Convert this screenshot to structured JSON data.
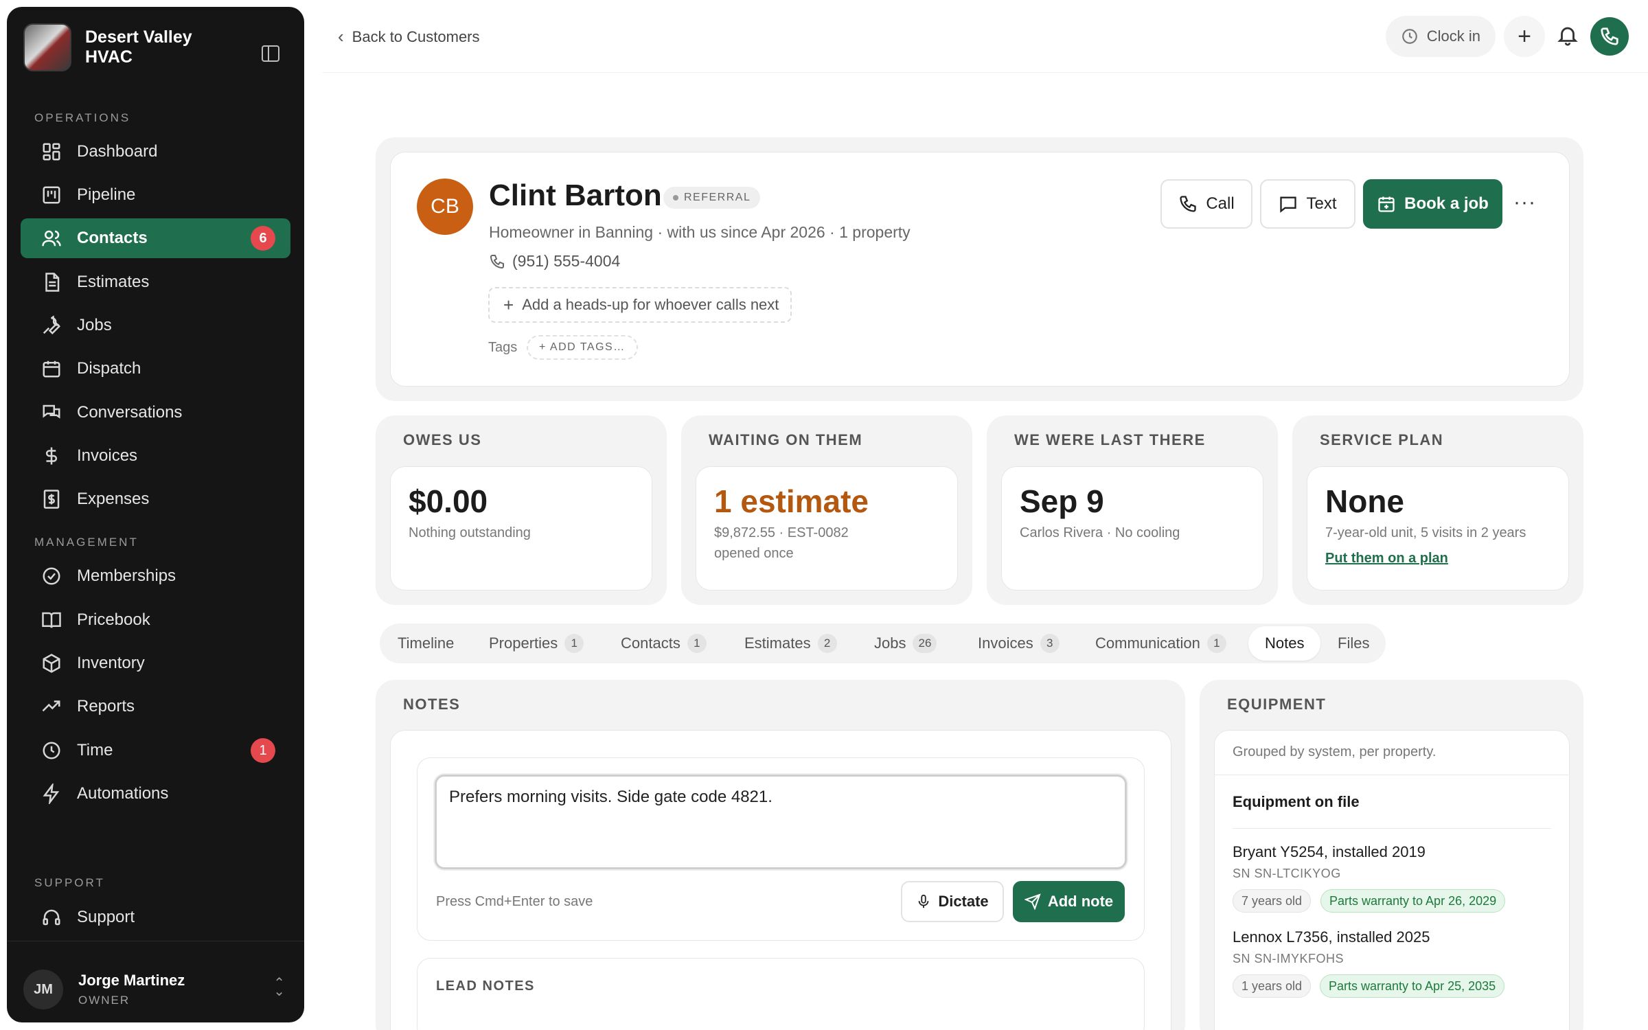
{
  "sidebar": {
    "brand_name": "Desert Valley HVAC",
    "sections": {
      "operations": "OPERATIONS",
      "management": "MANAGEMENT",
      "support": "SUPPORT"
    },
    "items": [
      {
        "label": "Dashboard",
        "icon": "dashboard-icon"
      },
      {
        "label": "Pipeline",
        "icon": "pipeline-icon"
      },
      {
        "label": "Contacts",
        "icon": "contacts-icon",
        "badge": "6",
        "active": true
      },
      {
        "label": "Estimates",
        "icon": "estimates-icon"
      },
      {
        "label": "Jobs",
        "icon": "wrench-icon"
      },
      {
        "label": "Dispatch",
        "icon": "calendar-icon"
      },
      {
        "label": "Conversations",
        "icon": "chat-icon"
      },
      {
        "label": "Invoices",
        "icon": "dollar-icon"
      },
      {
        "label": "Expenses",
        "icon": "receipt-icon"
      },
      {
        "label": "Memberships",
        "icon": "badge-check-icon"
      },
      {
        "label": "Pricebook",
        "icon": "book-icon"
      },
      {
        "label": "Inventory",
        "icon": "box-icon"
      },
      {
        "label": "Reports",
        "icon": "trend-icon"
      },
      {
        "label": "Time",
        "icon": "clock-icon",
        "badge": "1"
      },
      {
        "label": "Automations",
        "icon": "bolt-icon"
      },
      {
        "label": "Support",
        "icon": "headset-icon"
      }
    ],
    "user": {
      "initials": "JM",
      "name": "Jorge Martinez",
      "role": "OWNER"
    }
  },
  "topbar": {
    "back_label": "Back to Customers",
    "clock_label": "Clock in"
  },
  "customer": {
    "initials": "CB",
    "name": "Clint Barton",
    "tag": "REFERRAL",
    "subtitle": "Homeowner in Banning · with us since Apr 2026 · 1 property",
    "phone": "(951) 555-4004",
    "headsup_label": "Add a heads-up for whoever calls next",
    "tags_label": "Tags",
    "add_tags_label": "+ ADD TAGS…",
    "actions": {
      "call": "Call",
      "text": "Text",
      "book": "Book a job",
      "more": "···"
    }
  },
  "stats": [
    {
      "title": "OWES US",
      "value": "$0.00",
      "sub": [
        "Nothing outstanding"
      ]
    },
    {
      "title": "WAITING ON THEM",
      "value": "1 estimate",
      "sub": [
        "$9,872.55 · EST-0082",
        "opened once"
      ]
    },
    {
      "title": "WE WERE LAST THERE",
      "value": "Sep 9",
      "sub": [
        "Carlos Rivera · No cooling"
      ]
    },
    {
      "title": "SERVICE PLAN",
      "value": "None",
      "sub": [
        "7-year-old unit, 5 visits in 2 years"
      ],
      "link": "Put them on a plan"
    }
  ],
  "tabs": [
    {
      "label": "Timeline"
    },
    {
      "label": "Properties",
      "count": "1"
    },
    {
      "label": "Contacts",
      "count": "1"
    },
    {
      "label": "Estimates",
      "count": "2"
    },
    {
      "label": "Jobs",
      "count": "26"
    },
    {
      "label": "Invoices",
      "count": "3"
    },
    {
      "label": "Communication",
      "count": "1"
    },
    {
      "label": "Notes",
      "active": true
    },
    {
      "label": "Files"
    }
  ],
  "notes": {
    "title": "NOTES",
    "current_value": "Prefers morning visits. Side gate code 4821.",
    "hint": "Press Cmd+Enter to save",
    "dictate_label": "Dictate",
    "add_label": "Add note",
    "lead_notes_title": "LEAD NOTES"
  },
  "equipment": {
    "title": "EQUIPMENT",
    "hint": "Grouped by system, per property.",
    "heading": "Equipment on file",
    "items": [
      {
        "name": "Bryant Y5254, installed 2019",
        "sn": "SN SN-LTCIKYOG",
        "age": "7 years old",
        "warranty": "Parts warranty to Apr 26, 2029"
      },
      {
        "name": "Lennox L7356, installed 2025",
        "sn": "SN SN-IMYKFOHS",
        "age": "1 years old",
        "warranty": "Parts warranty to Apr 25, 2035"
      }
    ]
  },
  "colors": {
    "accent": "#1f6f4f",
    "sidebar_bg": "#151515",
    "badge_red": "#e5484d",
    "avatar_orange": "#c85f12"
  }
}
